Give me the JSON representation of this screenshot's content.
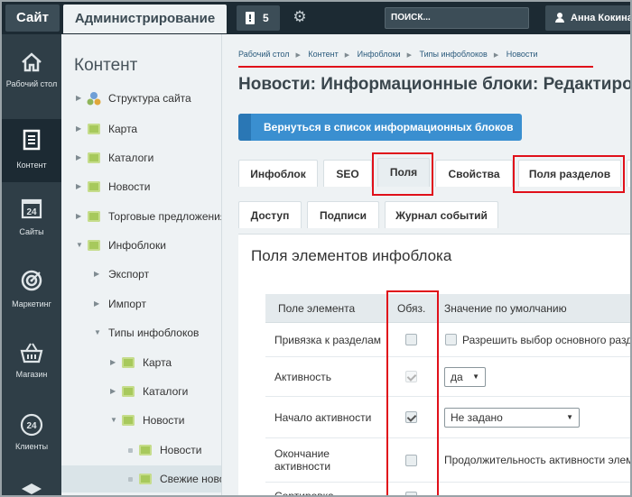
{
  "topbar": {
    "site_label": "Сайт",
    "admin_label": "Администрирование",
    "notifications_count": "5",
    "search_placeholder": "ПОИСК...",
    "user_name": "Анна Кокина"
  },
  "leftnav": [
    {
      "label": "Рабочий стол",
      "icon": "home-icon"
    },
    {
      "label": "Контент",
      "icon": "document-icon"
    },
    {
      "label": "Сайты",
      "icon": "calendar-icon"
    },
    {
      "label": "Маркетинг",
      "icon": "target-icon"
    },
    {
      "label": "Магазин",
      "icon": "basket-icon"
    },
    {
      "label": "Клиенты",
      "icon": "clients-icon"
    }
  ],
  "sidebar": {
    "title": "Контент",
    "items": [
      {
        "label": "Структура сайта"
      },
      {
        "label": "Карта"
      },
      {
        "label": "Каталоги"
      },
      {
        "label": "Новости"
      },
      {
        "label": "Торговые предложения"
      },
      {
        "label": "Инфоблоки"
      },
      {
        "label": "Экспорт"
      },
      {
        "label": "Импорт"
      },
      {
        "label": "Типы инфоблоков"
      },
      {
        "label": "Карта"
      },
      {
        "label": "Каталоги"
      },
      {
        "label": "Новости"
      },
      {
        "label": "Новости"
      },
      {
        "label": "Свежие новости"
      }
    ]
  },
  "breadcrumb": [
    "Рабочий стол",
    "Контент",
    "Инфоблоки",
    "Типы инфоблоков",
    "Новости"
  ],
  "page_title": "Новости: Информационные блоки: Редактирование",
  "back_button": "Вернуться в список информационных блоков",
  "tabs_row1": [
    "Инфоблок",
    "SEO",
    "Поля",
    "Свойства",
    "Поля разделов"
  ],
  "tabs_row2": [
    "Доступ",
    "Подписи",
    "Журнал событий"
  ],
  "panel_title": "Поля элементов инфоблока",
  "table": {
    "headers": [
      "Поле элемента",
      "Обяз.",
      "Значение по умолчанию"
    ],
    "rows": [
      {
        "name": "Привязка к разделам",
        "required": false,
        "default": "Разрешить выбор основного раздела"
      },
      {
        "name": "Активность",
        "required": true,
        "default": "да"
      },
      {
        "name": "Начало активности",
        "required": true,
        "default": "Не задано"
      },
      {
        "name": "Окончание активности",
        "required": false,
        "default": "Продолжительность активности элемента"
      },
      {
        "name": "Сортировка",
        "required": false,
        "default": ""
      }
    ]
  }
}
